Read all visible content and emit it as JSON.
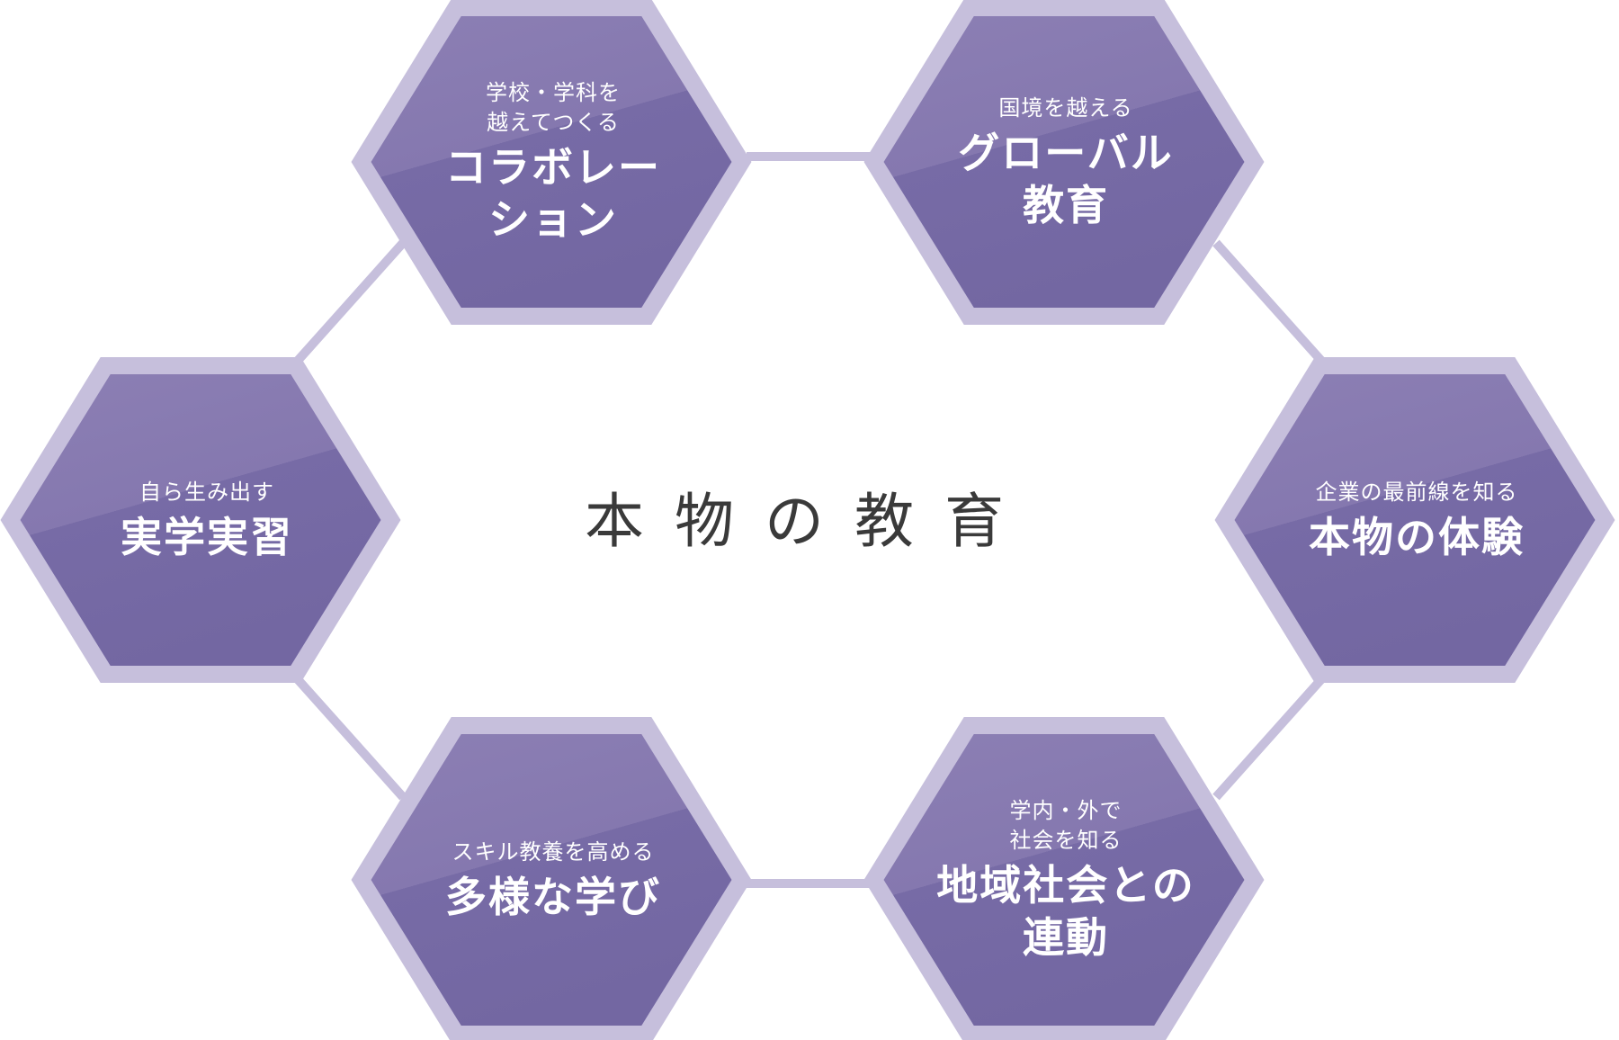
{
  "center_title": "本物の教育",
  "colors": {
    "hex_outer": "#c6bfdc",
    "hex_inner_light": "#8c7fb4",
    "hex_inner_dark": "#766aa5",
    "connector": "#c6bfdc",
    "title": "#3a3a3a"
  },
  "nodes": {
    "collaboration": {
      "sub": "学校・学科を\n越えてつくる",
      "main": "コラボレー\nション"
    },
    "global": {
      "sub": "国境を越える",
      "main": "グローバル\n教育"
    },
    "practical": {
      "sub": "自ら生み出す",
      "main": "実学実習"
    },
    "real_experience": {
      "sub": "企業の最前線を知る",
      "main": "本物の体験"
    },
    "diverse_learning": {
      "sub": "スキル教養を高める",
      "main": "多様な学び"
    },
    "community": {
      "sub": "学内・外で\n社会を知る",
      "main": "地域社会との\n連動"
    }
  }
}
